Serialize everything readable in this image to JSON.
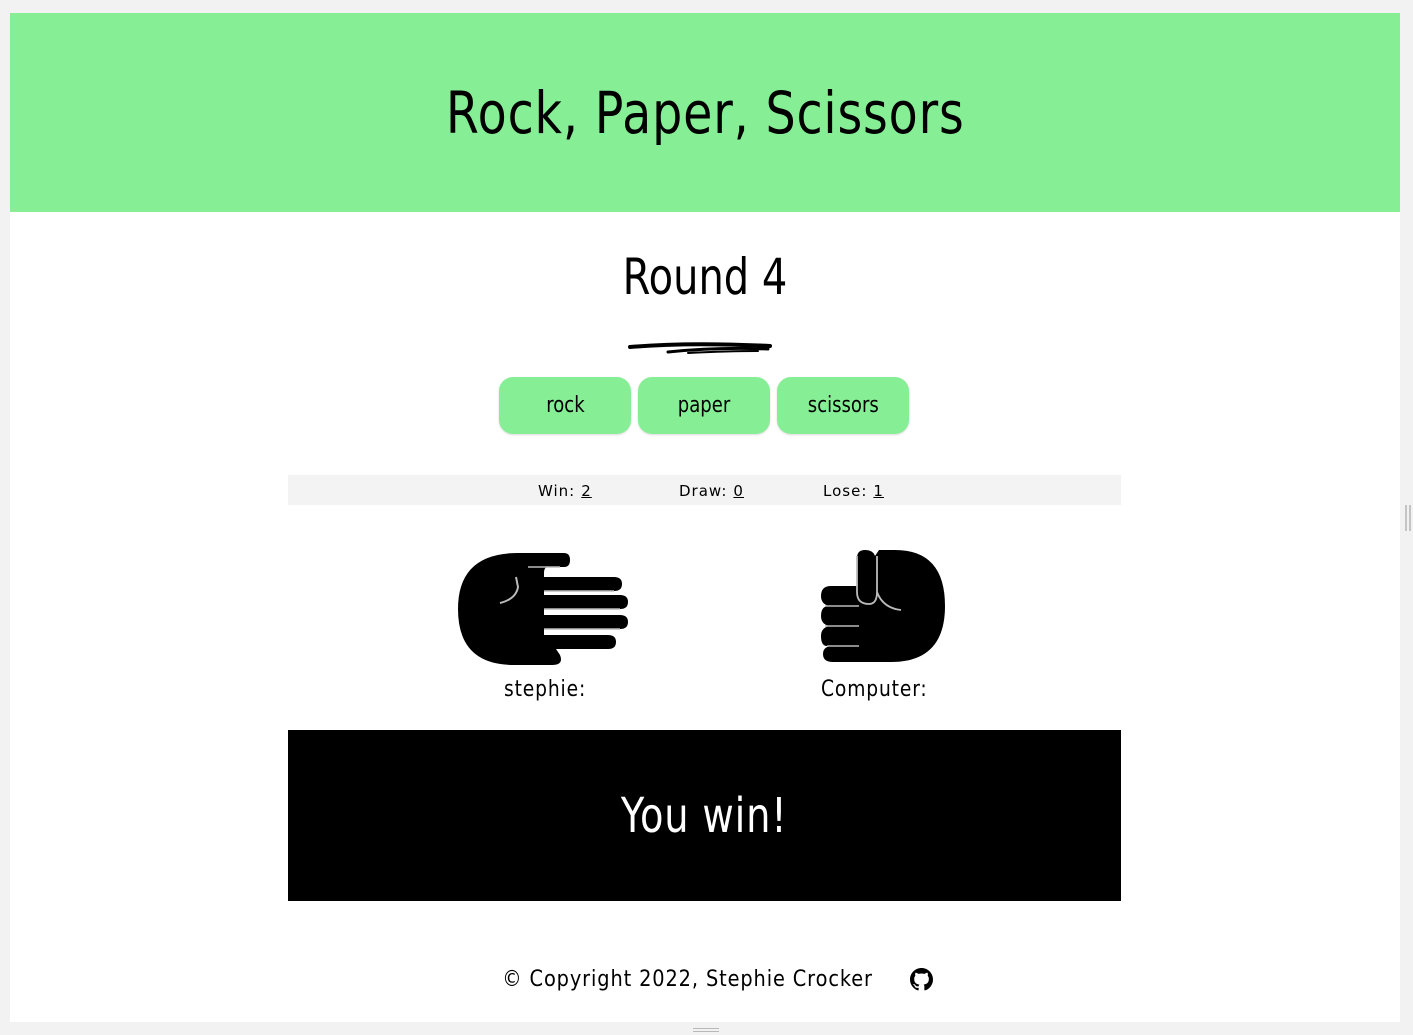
{
  "header": {
    "title": "Rock, Paper, Scissors",
    "background_color": "#86ef96"
  },
  "round": {
    "label": "Round 4"
  },
  "choices": [
    {
      "label": "rock"
    },
    {
      "label": "paper"
    },
    {
      "label": "scissors"
    }
  ],
  "score": {
    "win_label": "Win:",
    "win_value": "2",
    "draw_label": "Draw:",
    "draw_value": "0",
    "lose_label": "Lose:",
    "lose_value": "1"
  },
  "players": {
    "player_name": "stephie:",
    "player_hand_icon": "paper-hand-icon",
    "computer_name": "Computer:",
    "computer_hand_icon": "rock-hand-icon"
  },
  "result": {
    "text": "You win!"
  },
  "footer": {
    "text": "© Copyright 2022, Stephie Crocker",
    "icon": "github-icon"
  }
}
